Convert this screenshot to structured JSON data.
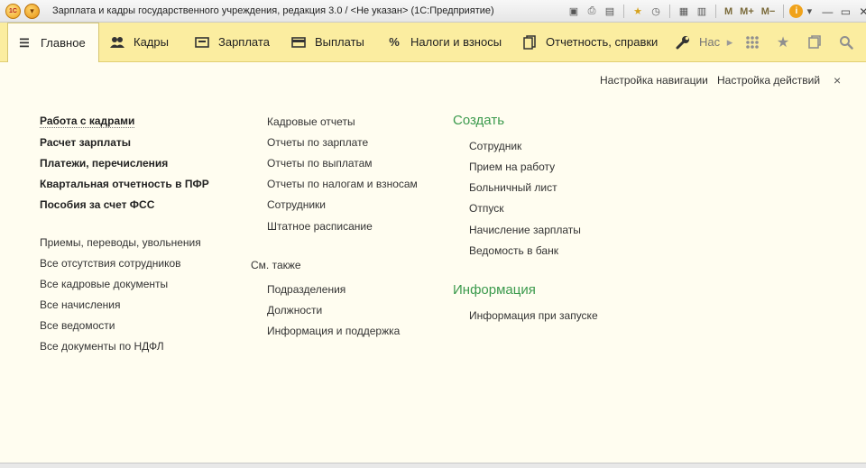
{
  "window": {
    "title": "Зарплата и кадры государственного учреждения, редакция 3.0 / <Не указан>  (1С:Предприятие)",
    "logo_text": "1C",
    "menu_button_glyph": "▾",
    "toolbar": [
      {
        "icon": "save-icon",
        "glyph": "▣"
      },
      {
        "icon": "print-icon",
        "glyph": "⎙"
      },
      {
        "icon": "preview-icon",
        "glyph": "▤"
      },
      {
        "icon": "favorite-icon",
        "glyph": "★"
      },
      {
        "icon": "history-icon",
        "glyph": "◷"
      },
      {
        "icon": "calculator-icon",
        "glyph": "▦"
      },
      {
        "icon": "calendar-icon",
        "glyph": "▥"
      }
    ],
    "memory_buttons": [
      "M",
      "M+",
      "M−"
    ],
    "info_glyph": "i",
    "dropdown_glyph": "▾",
    "minimize_glyph": "—",
    "maximize_glyph": "▭",
    "close_glyph": "✕"
  },
  "sections": [
    {
      "label": "Главное",
      "icon": "hamburger-icon",
      "glyph": "☰",
      "active": true
    },
    {
      "label": "Кадры",
      "icon": "people-icon",
      "glyph": "👥"
    },
    {
      "label": "Зарплата",
      "icon": "payroll-icon",
      "glyph": "▭"
    },
    {
      "label": "Выплаты",
      "icon": "payments-icon",
      "glyph": "▬"
    },
    {
      "label": "Налоги и взносы",
      "icon": "percent-icon",
      "glyph": "%"
    },
    {
      "label": "Отчетность, справки",
      "icon": "reports-icon",
      "glyph": "⧉"
    },
    {
      "label": "Нас",
      "icon": "wrench-icon",
      "glyph": "🔧"
    }
  ],
  "section_controls": {
    "scroll_right": "▸",
    "all_functions": "⁞⁞⁞",
    "favorites": "★",
    "history": "▢",
    "search": "⚲"
  },
  "top_links": {
    "nav_settings": "Настройка навигации",
    "action_settings": "Настройка действий",
    "close": "×"
  },
  "col1_bold": [
    "Работа с кадрами",
    "Расчет зарплаты",
    "Платежи, перечисления",
    "Квартальная отчетность в ПФР",
    "Пособия за счет ФСС"
  ],
  "col1_links": [
    "Приемы, переводы, увольнения",
    "Все отсутствия сотрудников",
    "Все кадровые документы",
    "Все начисления",
    "Все ведомости",
    "Все документы по НДФЛ"
  ],
  "col2_links": [
    "Кадровые отчеты",
    "Отчеты по зарплате",
    "Отчеты по выплатам",
    "Отчеты по налогам и взносам",
    "Сотрудники",
    "Штатное расписание"
  ],
  "see_also": {
    "label": "См. также",
    "links": [
      "Подразделения",
      "Должности",
      "Информация и поддержка"
    ]
  },
  "create": {
    "title": "Создать",
    "links": [
      "Сотрудник",
      "Прием на работу",
      "Больничный лист",
      "Отпуск",
      "Начисление зарплаты",
      "Ведомость в банк"
    ]
  },
  "information": {
    "title": "Информация",
    "links": [
      "Информация при запуске"
    ]
  }
}
